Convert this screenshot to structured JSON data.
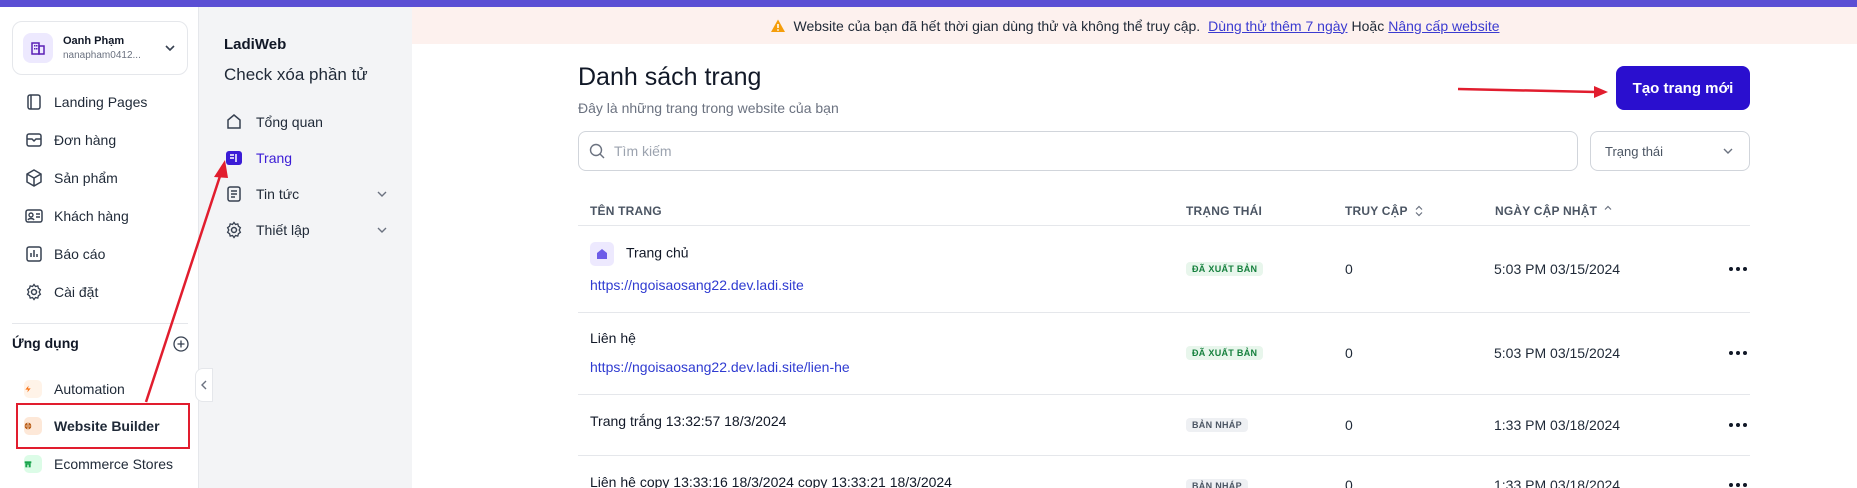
{
  "account": {
    "name": "Oanh Phạm",
    "email": "nanapham0412..."
  },
  "sidebar": {
    "items": [
      {
        "label": "Landing Pages",
        "icon": "landing-pages-icon"
      },
      {
        "label": "Đơn hàng",
        "icon": "orders-icon"
      },
      {
        "label": "Sản phẩm",
        "icon": "product-box-icon"
      },
      {
        "label": "Khách hàng",
        "icon": "contact-card-icon"
      },
      {
        "label": "Báo cáo",
        "icon": "report-chart-icon"
      },
      {
        "label": "Cài đặt",
        "icon": "gear-icon"
      }
    ],
    "apps_title": "Ứng dụng",
    "apps": [
      {
        "label": "Automation",
        "icon": "lightning-icon",
        "color": "#f97316"
      },
      {
        "label": "Website Builder",
        "icon": "globe-icon",
        "color": "#b45309"
      },
      {
        "label": "Ecommerce Stores",
        "icon": "store-icon",
        "color": "#16a34a"
      }
    ]
  },
  "site_nav": {
    "site_name": "LadiWeb",
    "site_subtitle": "Check xóa phần tử",
    "items": [
      {
        "label": "Tổng quan",
        "icon": "home-icon"
      },
      {
        "label": "Trang",
        "icon": "pages-icon",
        "active": true
      },
      {
        "label": "Tin tức",
        "icon": "news-icon"
      },
      {
        "label": "Thiết lập",
        "icon": "gear-icon"
      }
    ]
  },
  "banner": {
    "message": "Website của bạn đã hết thời gian dùng thử và không thể truy cập.",
    "trial_link": "Dùng thử thêm 7 ngày",
    "or_text": "Hoặc",
    "upgrade_link": "Nâng cấp website"
  },
  "main": {
    "title": "Danh sách trang",
    "subtitle": "Đây là những trang trong website của bạn",
    "create_button": "Tạo trang mới",
    "search_placeholder": "Tìm kiếm",
    "status_filter": "Trạng thái",
    "columns": {
      "name": "TÊN TRANG",
      "status": "TRẠNG THÁI",
      "visits": "TRUY CẬP",
      "updated": "NGÀY CẬP NHẬT"
    },
    "rows": [
      {
        "name": "Trang chủ",
        "url": "https://ngoisaosang22.dev.ladi.site",
        "status": "ĐÃ XUẤT BẢN",
        "visits": "0",
        "updated": "5:03 PM 03/15/2024"
      },
      {
        "name": "Liên hệ",
        "url": "https://ngoisaosang22.dev.ladi.site/lien-he",
        "status": "ĐÃ XUẤT BẢN",
        "visits": "0",
        "updated": "5:03 PM 03/15/2024"
      },
      {
        "name": "Trang trắng 13:32:57 18/3/2024",
        "url": "",
        "status": "BẢN NHÁP",
        "visits": "0",
        "updated": "1:33 PM 03/18/2024"
      },
      {
        "name": "Liên hệ copy 13:33:16 18/3/2024 copy 13:33:21 18/3/2024",
        "url": "",
        "status": "BẢN NHÁP",
        "visits": "0",
        "updated": "1:33 PM 03/18/2024"
      }
    ]
  },
  "colors": {
    "accent": "#2a0fcf",
    "annotation": "#e11d2e"
  }
}
